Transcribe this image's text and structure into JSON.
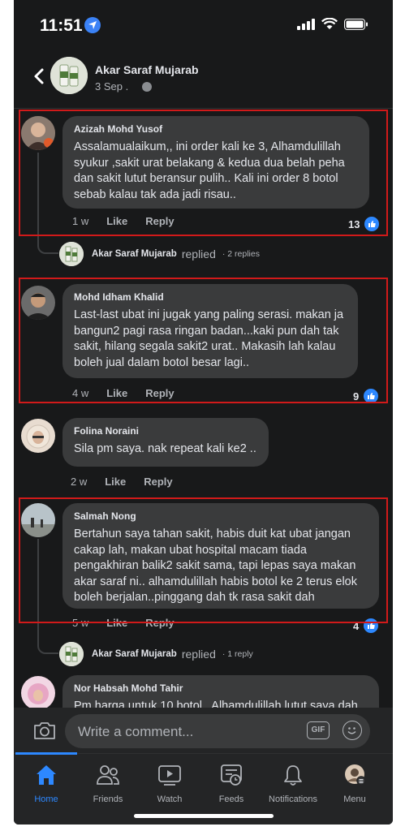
{
  "status_bar": {
    "time": "11:51"
  },
  "post_header": {
    "page_name": "Akar Saraf Mujarab",
    "date": "3 Sep ."
  },
  "comments": [
    {
      "author": "Azizah Mohd Yusof",
      "text": "Assalamualaikum,, ini order kali ke 3, Alhamdulillah syukur ,sakit urat belakang & kedua dua belah peha dan sakit lutut beransur pulih.. Kali ini order 8 botol sebab kalau tak ada jadi risau..",
      "time": "1 w",
      "like_label": "Like",
      "reply_label": "Reply",
      "reaction_count": "13"
    },
    {
      "author": "Mohd Idham Khalid",
      "text": "Last-last ubat ini jugak yang paling serasi. makan ja bangun2 pagi rasa ringan badan...kaki pun dah tak sakit, hilang segala sakit2 urat.. Makasih lah kalau boleh jual dalam botol besar lagi..",
      "time": "4 w",
      "like_label": "Like",
      "reply_label": "Reply",
      "reaction_count": "9"
    },
    {
      "author": "Folina Noraini",
      "text": "Sila pm saya. nak repeat kali ke2 ..",
      "time": "2 w",
      "like_label": "Like",
      "reply_label": "Reply"
    },
    {
      "author": "Salmah Nong",
      "text": "Bertahun saya tahan sakit, habis duit kat ubat jangan cakap lah, makan ubat hospital macam tiada pengakhiran balik2 sakit sama, tapi lepas saya makan akar saraf ni.. alhamdulillah habis botol ke 2 terus elok boleh berjalan..pinggang dah tk rasa sakit dah",
      "time": "5 w",
      "like_label": "Like",
      "reply_label": "Reply",
      "reaction_count": "4"
    },
    {
      "author": "Nor Habsah Mohd Tahir",
      "text": "Pm harga untuk 10 botol.. Alhamdulillah lutut saya dah"
    }
  ],
  "replies": [
    {
      "name": "Akar Saraf Mujarab",
      "replied": "replied",
      "count": "· 2 replies"
    },
    {
      "name": "Akar Saraf Mujarab",
      "replied": "replied",
      "count": "· 1 reply"
    }
  ],
  "composer": {
    "placeholder": "Write a comment...",
    "gif_label": "GIF"
  },
  "tabs": [
    {
      "label": "Home",
      "icon": "home-icon",
      "active": true
    },
    {
      "label": "Friends",
      "icon": "friends-icon"
    },
    {
      "label": "Watch",
      "icon": "watch-icon"
    },
    {
      "label": "Feeds",
      "icon": "feeds-icon"
    },
    {
      "label": "Notifications",
      "icon": "bell-icon"
    },
    {
      "label": "Menu",
      "icon": "menu-avatar-icon"
    }
  ],
  "colors": {
    "accent": "#2d88ff",
    "highlight_box": "#d11a1a",
    "background": "#18191a",
    "bubble": "#3a3b3c"
  }
}
